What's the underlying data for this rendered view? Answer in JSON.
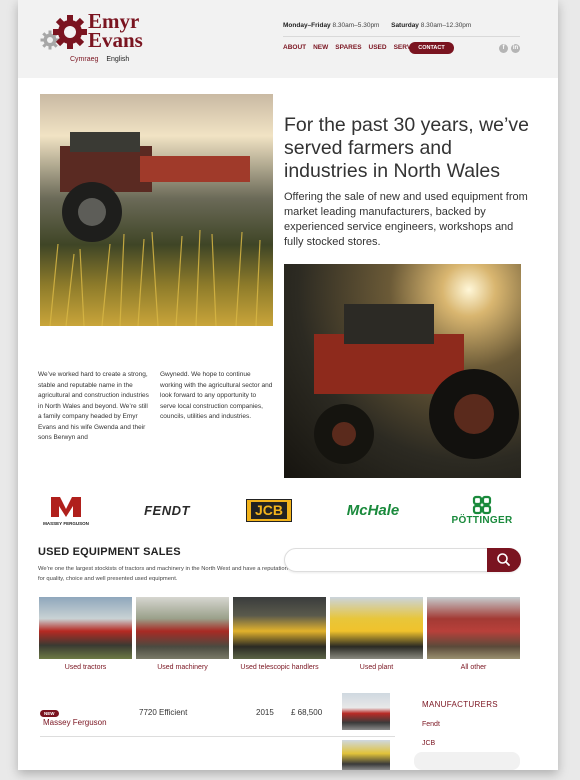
{
  "header": {
    "logo_line1": "Emyr",
    "logo_line2": "Evans",
    "lang_cy": "Cymraeg",
    "lang_en": "English",
    "hours_weekday_label": "Monday–Friday",
    "hours_weekday": "8.30am–5.30pm",
    "hours_saturday_label": "Saturday",
    "hours_saturday": "8.30am–12.30pm",
    "nav": [
      "ABOUT",
      "NEW",
      "SPARES",
      "USED",
      "SERVICE"
    ],
    "contact_label": "CONTACT",
    "social": [
      "facebook-icon",
      "linkedin-icon"
    ]
  },
  "hero": {
    "title": "For the past 30 years, we’ve served farmers and industries in North Wales",
    "subtitle": "Offering the sale of new and used equipment from market leading manufacturers, backed by experienced service engineers, workshops and fully stocked stores.",
    "about_col1": "We’ve worked hard to create a strong, stable and reputable name in the agricultural and construction industries in North Wales and beyond. We’re still a family company headed by Emyr Evans and his wife Gwenda and their sons Berwyn and",
    "about_col2": "Gwynedd. We hope to continue working with the agricultural sector and look forward to any opportunity to serve local construction companies, councils, utilities and industries."
  },
  "brands": {
    "massey_line1": "MASSEY FERGUSON",
    "fendt": "FENDT",
    "jcb": "JCB",
    "mchale": "McHale",
    "pottinger": "PÖTTINGER"
  },
  "used": {
    "title": "USED EQUIPMENT SALES",
    "description": "We’re one the largest stockists of tractors and machinery in the North West and have a reputation for quality, choice and well presented used equipment.",
    "search_placeholder": "",
    "categories": [
      "Used tractors",
      "Used machinery",
      "Used telescopic handlers",
      "Used plant",
      "All other"
    ]
  },
  "listing": {
    "badge": "NEW",
    "make": "Massey Ferguson",
    "model": "7720 Efficient",
    "year": "2015",
    "price": "£ 68,500"
  },
  "manufacturers": {
    "title": "MANUFACTURERS",
    "items": [
      "Fendt",
      "JCB"
    ]
  },
  "colors": {
    "brand": "#7a1420",
    "background": "#e9e9e9",
    "header": "#f2f2f2"
  }
}
